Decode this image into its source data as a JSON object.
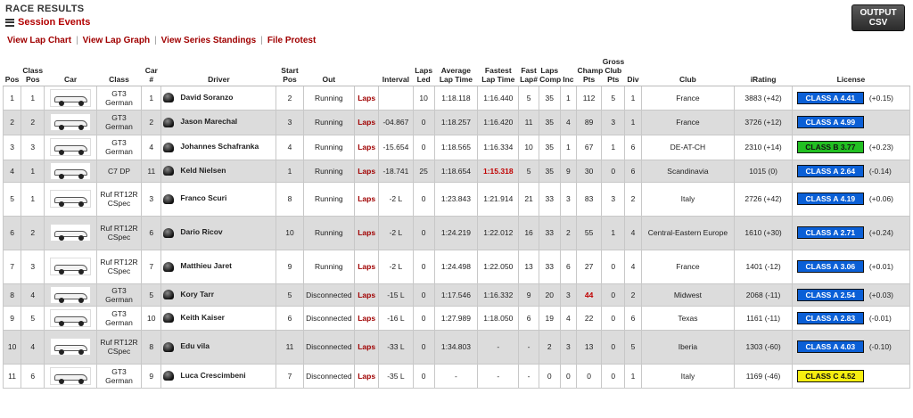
{
  "header": {
    "title": "RACE RESULTS",
    "session_events": "Session Events",
    "output_csv_line1": "OUTPUT",
    "output_csv_line2": "CSV"
  },
  "links": {
    "lap_chart": "View Lap Chart",
    "lap_graph": "View Lap Graph",
    "series_standings": "View Series Standings",
    "file_protest": "File Protest"
  },
  "columns": {
    "pos": "Pos",
    "class_pos": "Class Pos",
    "car": "Car",
    "class": "Class",
    "car_num": "Car #",
    "driver": "Driver",
    "start_pos": "Start Pos",
    "out": "Out",
    "laps_link": "",
    "interval": "Interval",
    "laps_led": "Laps Led",
    "avg_lap": "Average Lap Time",
    "fastest_lap": "Fastest Lap Time",
    "fast_lap_num": "Fast Lap#",
    "laps_comp": "Laps Comp",
    "inc": "Inc",
    "champ_pts": "Champ Pts",
    "gross_club_pts": "Gross Club Pts",
    "div": "Div",
    "club": "Club",
    "irating": "iRating",
    "license": "License"
  },
  "rows": [
    {
      "pos": "1",
      "class_pos": "1",
      "class": "GT3 German",
      "car_num": "1",
      "driver": "David Soranzo",
      "start": "2",
      "out": "Running",
      "laps_link": "Laps",
      "interval": "",
      "led": "10",
      "avg": "1:18.118",
      "fastest": "1:16.440",
      "fastest_red": false,
      "fast_lap": "5",
      "comp": "35",
      "inc": "1",
      "champ": "112",
      "champ_red": false,
      "club_pts": "5",
      "div": "1",
      "club": "France",
      "irating": "3883 (+42)",
      "license": "CLASS A 4.41",
      "lic_color": "blue",
      "lic_delta": "(+0.15)"
    },
    {
      "pos": "2",
      "class_pos": "2",
      "class": "GT3 German",
      "car_num": "2",
      "driver": "Jason Marechal",
      "start": "3",
      "out": "Running",
      "laps_link": "Laps",
      "interval": "-04.867",
      "led": "0",
      "avg": "1:18.257",
      "fastest": "1:16.420",
      "fastest_red": false,
      "fast_lap": "11",
      "comp": "35",
      "inc": "4",
      "champ": "89",
      "champ_red": false,
      "club_pts": "3",
      "div": "1",
      "club": "France",
      "irating": "3726 (+12)",
      "license": "CLASS A 4.99",
      "lic_color": "blue",
      "lic_delta": ""
    },
    {
      "pos": "3",
      "class_pos": "3",
      "class": "GT3 German",
      "car_num": "4",
      "driver": "Johannes Schafranka",
      "start": "4",
      "out": "Running",
      "laps_link": "Laps",
      "interval": "-15.654",
      "led": "0",
      "avg": "1:18.565",
      "fastest": "1:16.334",
      "fastest_red": false,
      "fast_lap": "10",
      "comp": "35",
      "inc": "1",
      "champ": "67",
      "champ_red": false,
      "club_pts": "1",
      "div": "6",
      "club": "DE-AT-CH",
      "irating": "2310 (+14)",
      "license": "CLASS B 3.77",
      "lic_color": "green",
      "lic_delta": "(+0.23)"
    },
    {
      "pos": "4",
      "class_pos": "1",
      "class": "C7 DP",
      "car_num": "11",
      "driver": "Keld Nielsen",
      "start": "1",
      "out": "Running",
      "laps_link": "Laps",
      "interval": "-18.741",
      "led": "25",
      "avg": "1:18.654",
      "fastest": "1:15.318",
      "fastest_red": true,
      "fast_lap": "5",
      "comp": "35",
      "inc": "9",
      "champ": "30",
      "champ_red": false,
      "club_pts": "0",
      "div": "6",
      "club": "Scandinavia",
      "irating": "1015 (0)",
      "license": "CLASS A 2.64",
      "lic_color": "blue",
      "lic_delta": "(-0.14)"
    },
    {
      "pos": "5",
      "class_pos": "1",
      "class": "Ruf RT12R CSpec",
      "car_num": "3",
      "driver": "Franco Scuri",
      "start": "8",
      "out": "Running",
      "laps_link": "Laps",
      "interval": "-2 L",
      "led": "0",
      "avg": "1:23.843",
      "fastest": "1:21.914",
      "fastest_red": false,
      "fast_lap": "21",
      "comp": "33",
      "inc": "3",
      "champ": "83",
      "champ_red": false,
      "club_pts": "3",
      "div": "2",
      "club": "Italy",
      "irating": "2726 (+42)",
      "license": "CLASS A 4.19",
      "lic_color": "blue",
      "lic_delta": "(+0.06)"
    },
    {
      "pos": "6",
      "class_pos": "2",
      "class": "Ruf RT12R CSpec",
      "car_num": "6",
      "driver": "Dario Ricov",
      "start": "10",
      "out": "Running",
      "laps_link": "Laps",
      "interval": "-2 L",
      "led": "0",
      "avg": "1:24.219",
      "fastest": "1:22.012",
      "fastest_red": false,
      "fast_lap": "16",
      "comp": "33",
      "inc": "2",
      "champ": "55",
      "champ_red": false,
      "club_pts": "1",
      "div": "4",
      "club": "Central-Eastern Europe",
      "irating": "1610 (+30)",
      "license": "CLASS A 2.71",
      "lic_color": "blue",
      "lic_delta": "(+0.24)"
    },
    {
      "pos": "7",
      "class_pos": "3",
      "class": "Ruf RT12R CSpec",
      "car_num": "7",
      "driver": "Matthieu Jaret",
      "start": "9",
      "out": "Running",
      "laps_link": "Laps",
      "interval": "-2 L",
      "led": "0",
      "avg": "1:24.498",
      "fastest": "1:22.050",
      "fastest_red": false,
      "fast_lap": "13",
      "comp": "33",
      "inc": "6",
      "champ": "27",
      "champ_red": false,
      "club_pts": "0",
      "div": "4",
      "club": "France",
      "irating": "1401 (-12)",
      "license": "CLASS A 3.06",
      "lic_color": "blue",
      "lic_delta": "(+0.01)"
    },
    {
      "pos": "8",
      "class_pos": "4",
      "class": "GT3 German",
      "car_num": "5",
      "driver": "Kory Tarr",
      "start": "5",
      "out": "Disconnected",
      "laps_link": "Laps",
      "interval": "-15 L",
      "led": "0",
      "avg": "1:17.546",
      "fastest": "1:16.332",
      "fastest_red": false,
      "fast_lap": "9",
      "comp": "20",
      "inc": "3",
      "champ": "44",
      "champ_red": true,
      "club_pts": "0",
      "div": "2",
      "club": "Midwest",
      "irating": "2068 (-11)",
      "license": "CLASS A 2.54",
      "lic_color": "blue",
      "lic_delta": "(+0.03)"
    },
    {
      "pos": "9",
      "class_pos": "5",
      "class": "GT3 German",
      "car_num": "10",
      "driver": "Keith Kaiser",
      "start": "6",
      "out": "Disconnected",
      "laps_link": "Laps",
      "interval": "-16 L",
      "led": "0",
      "avg": "1:27.989",
      "fastest": "1:18.050",
      "fastest_red": false,
      "fast_lap": "6",
      "comp": "19",
      "inc": "4",
      "champ": "22",
      "champ_red": false,
      "club_pts": "0",
      "div": "6",
      "club": "Texas",
      "irating": "1161 (-11)",
      "license": "CLASS A 2.83",
      "lic_color": "blue",
      "lic_delta": "(-0.01)"
    },
    {
      "pos": "10",
      "class_pos": "4",
      "class": "Ruf RT12R CSpec",
      "car_num": "8",
      "driver": "Edu vila",
      "start": "11",
      "out": "Disconnected",
      "laps_link": "Laps",
      "interval": "-33 L",
      "led": "0",
      "avg": "1:34.803",
      "fastest": "-",
      "fastest_red": false,
      "fast_lap": "-",
      "comp": "2",
      "inc": "3",
      "champ": "13",
      "champ_red": false,
      "club_pts": "0",
      "div": "5",
      "club": "Iberia",
      "irating": "1303 (-60)",
      "license": "CLASS A 4.03",
      "lic_color": "blue",
      "lic_delta": "(-0.10)"
    },
    {
      "pos": "11",
      "class_pos": "6",
      "class": "GT3 German",
      "car_num": "9",
      "driver": "Luca Crescimbeni",
      "start": "7",
      "out": "Disconnected",
      "laps_link": "Laps",
      "interval": "-35 L",
      "led": "0",
      "avg": "-",
      "fastest": "-",
      "fastest_red": false,
      "fast_lap": "-",
      "comp": "0",
      "inc": "0",
      "champ": "0",
      "champ_red": false,
      "club_pts": "0",
      "div": "1",
      "club": "Italy",
      "irating": "1169 (-46)",
      "license": "CLASS C 4.52",
      "lic_color": "yellow",
      "lic_delta": ""
    }
  ]
}
